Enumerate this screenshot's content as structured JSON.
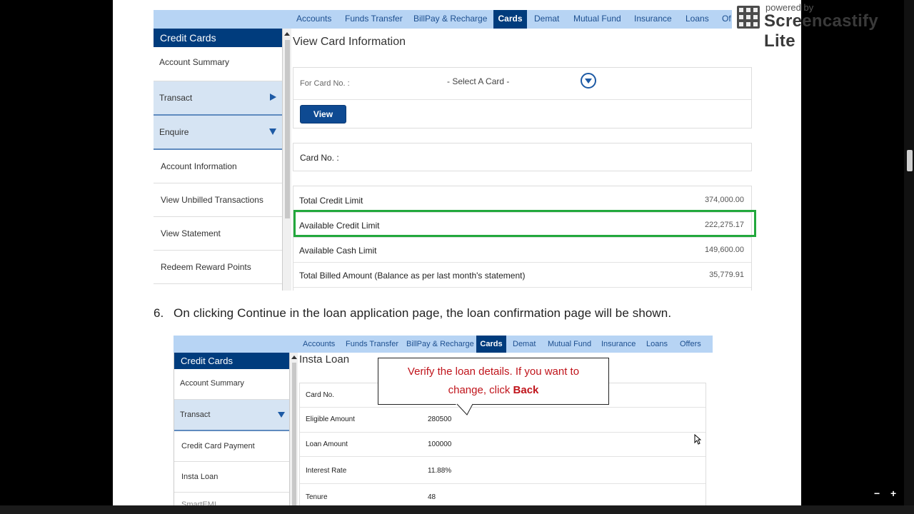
{
  "nav1": {
    "items": [
      "Accounts",
      "Funds Transfer",
      "BillPay & Recharge",
      "Cards",
      "Demat",
      "Mutual Fund",
      "Insurance",
      "Loans",
      "Of"
    ],
    "active": "Cards"
  },
  "sidebar1": {
    "header": "Credit Cards",
    "items": [
      "Account Summary",
      "Transact",
      "Enquire",
      "Account Information",
      "View Unbilled Transactions",
      "View Statement",
      "Redeem Reward Points"
    ]
  },
  "panel1": {
    "title": "View Card Information",
    "card_label": "For Card No. :",
    "select_placeholder": "- Select A Card -",
    "view_button": "View",
    "card_no_label": "Card No. :",
    "rows": [
      {
        "label": "Total Credit Limit",
        "value": "374,000.00"
      },
      {
        "label": "Available Credit Limit",
        "value": "222,275.17"
      },
      {
        "label": "Available Cash Limit",
        "value": "149,600.00"
      },
      {
        "label": "Total Billed Amount (Balance as per last month's statement)",
        "value": "35,779.91"
      }
    ]
  },
  "step": {
    "number": "6.",
    "text": "On clicking Continue in the loan application page, the loan confirmation page will be shown."
  },
  "nav2": {
    "items": [
      "Accounts",
      "Funds Transfer",
      "BillPay & Recharge",
      "Cards",
      "Demat",
      "Mutual Fund",
      "Insurance",
      "Loans",
      "Offers"
    ],
    "active": "Cards"
  },
  "sidebar2": {
    "header": "Credit Cards",
    "items": [
      "Account Summary",
      "Transact",
      "Credit Card Payment",
      "Insta Loan",
      "SmartEMI"
    ]
  },
  "panel2": {
    "title": "Insta Loan",
    "rows": [
      {
        "label": "Card No.",
        "value": ""
      },
      {
        "label": "Eligible Amount",
        "value": "280500"
      },
      {
        "label": "Loan Amount",
        "value": "100000"
      },
      {
        "label": "Interest Rate",
        "value": "11.88%"
      },
      {
        "label": "Tenure",
        "value": "48"
      }
    ]
  },
  "callout": {
    "line1": "Verify the loan details. If you want to",
    "line2_prefix": "change, click ",
    "line2_bold": "Back"
  },
  "watermark": {
    "small": "powered by",
    "big": "Screencastify Lite"
  },
  "player": {
    "zoom_out": "−",
    "zoom_in": "+"
  },
  "colors": {
    "highlight": "#22a83c",
    "nav_active": "#003c7d",
    "callout_text": "#c0141b"
  }
}
